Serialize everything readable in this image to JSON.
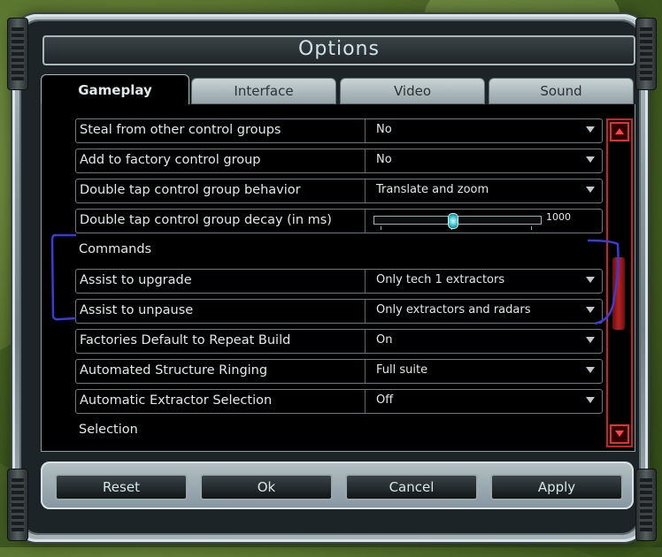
{
  "dialog": {
    "title": "Options"
  },
  "tabs": [
    {
      "label": "Gameplay",
      "active": true
    },
    {
      "label": "Interface",
      "active": false
    },
    {
      "label": "Video",
      "active": false
    },
    {
      "label": "Sound",
      "active": false
    }
  ],
  "settings": {
    "rows": [
      {
        "label": "Steal from other control groups",
        "value": "No"
      },
      {
        "label": "Add to factory control group",
        "value": "No"
      },
      {
        "label": "Double tap control group behavior",
        "value": "Translate and zoom"
      },
      {
        "label": "Double tap control group decay (in ms)",
        "slider_value": "1000",
        "slider_fraction": 0.47
      },
      {
        "label": "Assist to upgrade",
        "value": "Only tech 1 extractors"
      },
      {
        "label": "Assist to unpause",
        "value": "Only extractors and radars"
      },
      {
        "label": "Factories Default to Repeat Build",
        "value": "On"
      },
      {
        "label": "Automated Structure Ringing",
        "value": "Full suite"
      },
      {
        "label": "Automatic Extractor Selection",
        "value": "Off"
      }
    ],
    "sections": {
      "commands": "Commands",
      "selection": "Selection"
    }
  },
  "scrollbar": {
    "position_fraction": 0.55
  },
  "buttons": {
    "reset": "Reset",
    "ok": "Ok",
    "cancel": "Cancel",
    "apply": "Apply"
  },
  "colors": {
    "scrollbar_accent": "#cc2222",
    "annotation": "#3b3bd8",
    "slider_knob": "#33b6c9"
  }
}
